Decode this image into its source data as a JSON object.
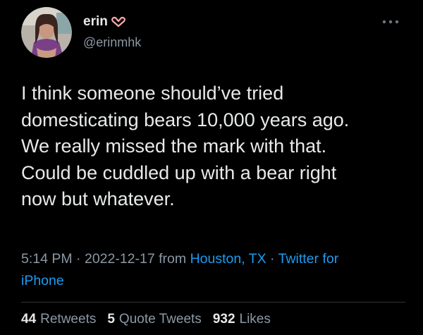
{
  "user": {
    "display_name": "erin",
    "badge_icon": "heart-hands-icon",
    "handle": "@erinmhk"
  },
  "menu": {
    "icon": "more-horizontal-icon"
  },
  "tweet": {
    "text": "I think someone should’ve tried\ndomesticating bears 10,000 years ago.\nWe really missed the mark with that.\nCould be cuddled up with a bear right\nnow but whatever."
  },
  "meta": {
    "time": "5:14 PM",
    "separator": "·",
    "date": "2022-12-17",
    "from_label": "from",
    "location": "Houston, TX",
    "client_line1": "Twitter for",
    "client_line2": "iPhone"
  },
  "stats": {
    "retweets_count": "44",
    "retweets_label": "Retweets",
    "quotes_count": "5",
    "quotes_label": "Quote Tweets",
    "likes_count": "932",
    "likes_label": "Likes"
  },
  "colors": {
    "background": "#000000",
    "text": "#e7e9ea",
    "secondary": "#8b98a5",
    "link": "#1d9bf0",
    "divider": "#2f3336",
    "badge": "#f4a8a8"
  }
}
